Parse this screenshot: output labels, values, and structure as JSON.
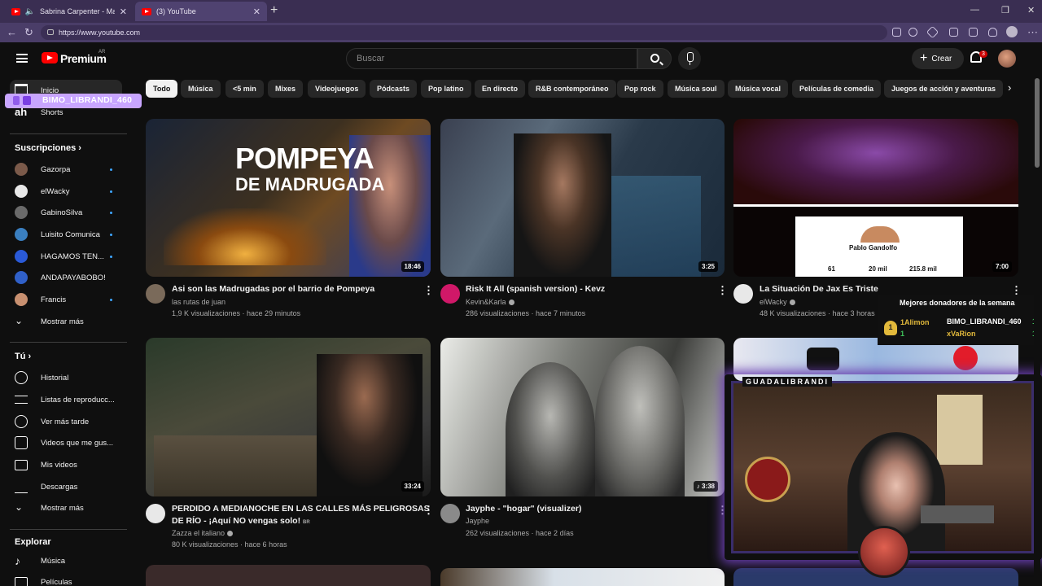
{
  "browser": {
    "tabs": [
      {
        "label": "Sabrina Carpenter - Manchild"
      },
      {
        "label": "(3) YouTube"
      }
    ],
    "url": "https://www.youtube.com"
  },
  "masthead": {
    "brand": "Premium",
    "country": "AR",
    "search_placeholder": "Buscar",
    "create_label": "Crear",
    "notif_count": "3"
  },
  "sidebar": {
    "top": [
      {
        "label": "Inicio",
        "icon": "home-icon"
      },
      {
        "label": "Shorts",
        "icon": "shorts-icon"
      }
    ],
    "subscriptions_title": "Suscripciones",
    "subscriptions": [
      {
        "label": "Gazorpa",
        "color": "#7b5a4a"
      },
      {
        "label": "elWacky",
        "color": "#e8e8e8"
      },
      {
        "label": "GabinoSilva",
        "color": "#6a6a6a"
      },
      {
        "label": "Luisito Comunica",
        "color": "#3a7fc0"
      },
      {
        "label": "HAGAMOS TEN...",
        "color": "#2a5ad8"
      },
      {
        "label": "ANDAPAYABOBO!",
        "color": "#3060c8"
      },
      {
        "label": "Francis",
        "color": "#c89070"
      }
    ],
    "show_more": "Mostrar más",
    "you_title": "Tú",
    "you_items": [
      {
        "label": "Historial",
        "icon": "history-icon"
      },
      {
        "label": "Listas de reproducc...",
        "icon": "playlist-icon"
      },
      {
        "label": "Ver más tarde",
        "icon": "watch-later-icon"
      },
      {
        "label": "Videos que me gus...",
        "icon": "like-icon"
      },
      {
        "label": "Mis videos",
        "icon": "my-videos-icon"
      },
      {
        "label": "Descargas",
        "icon": "download-icon"
      },
      {
        "label": "Mostrar más",
        "icon": "chevron-down-icon"
      }
    ],
    "explore_title": "Explorar",
    "explore_items": [
      {
        "label": "Música",
        "icon": "music-icon"
      },
      {
        "label": "Películas",
        "icon": "movies-icon"
      }
    ]
  },
  "overlay": {
    "twitch_user": "BIMO_LIBRANDI_460",
    "donors_title": "Mejores donadores de la semana",
    "donors": [
      {
        "rank": "1",
        "name": "1Alimon",
        "amount": "1"
      },
      {
        "name": "BIMO_LIBRANDI_460",
        "amount": "1"
      },
      {
        "name": "xVaRion",
        "amount": "1"
      }
    ],
    "cam_label": "GUADALIBRANDI"
  },
  "chips": [
    "Todo",
    "Música",
    "<5 min",
    "Mixes",
    "Videojuegos",
    "Pódcasts",
    "Pop latino",
    "En directo",
    "R&B contemporáneo",
    "Pop rock",
    "Música soul",
    "Música vocal",
    "Películas de comedia",
    "Juegos de acción y aventuras"
  ],
  "videos": [
    {
      "title": "Asi son las Madrugadas por el barrio de Pompeya",
      "channel": "las rutas de juan",
      "stats": "1,9 K visualizaciones · hace 29 minutos",
      "duration": "18:46",
      "thumb_title": "POMPEYA",
      "thumb_sub": "DE MADRUGADA"
    },
    {
      "title": "Risk It All (spanish version) - Kevz",
      "channel": "Kevin&Karla",
      "stats": "286 visualizaciones · hace 7 minutos",
      "duration": "3:25"
    },
    {
      "title": "La Situación De Jax Es Triste",
      "channel": "elWacky",
      "stats": "48 K visualizaciones · hace 3 horas",
      "duration": "7:00",
      "profile_name": "Pablo Gandolfo",
      "profile_stats": [
        "61",
        "20 mil",
        "215.8 mil"
      ]
    },
    {
      "title": "PERDIDO A MEDIANOCHE EN LAS CALLES MÁS PELIGROSAS",
      "title2": "DE RÍO - ¡Aquí NO vengas solo!",
      "badge": "BR",
      "channel": "Zazza el italiano",
      "stats": "80 K visualizaciones · hace 6 horas",
      "duration": "33:24"
    },
    {
      "title": "Jayphe - \"hogar\" (visualizer)",
      "channel": "Jayphe",
      "stats": "262 visualizaciones · hace 2 días",
      "duration": "3:38"
    }
  ]
}
